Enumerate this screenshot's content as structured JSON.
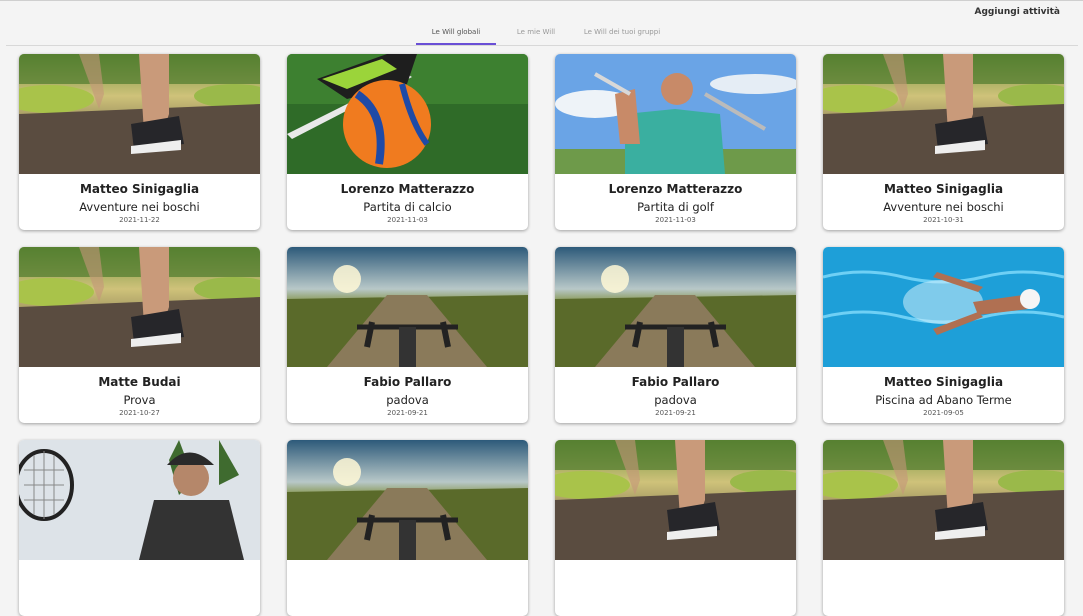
{
  "header": {
    "add_activity_label": "Aggiungi attività"
  },
  "tabs": [
    {
      "label": "Le Will globali",
      "active": true
    },
    {
      "label": "Le mie Will",
      "active": false
    },
    {
      "label": "Le Will dei tuoi gruppi",
      "active": false
    }
  ],
  "accent_color": "#6a4fd6",
  "cards": [
    {
      "name": "Matteo Sinigaglia",
      "activity": "Avventure nei boschi",
      "date": "2021-11-22",
      "image": "walking-photo"
    },
    {
      "name": "Lorenzo Matterazzo",
      "activity": "Partita di calcio",
      "date": "2021-11-03",
      "image": "soccer-photo"
    },
    {
      "name": "Lorenzo Matterazzo",
      "activity": "Partita di golf",
      "date": "2021-11-03",
      "image": "golf-photo"
    },
    {
      "name": "Matteo Sinigaglia",
      "activity": "Avventure nei boschi",
      "date": "2021-10-31",
      "image": "walking-photo"
    },
    {
      "name": "Matte Budai",
      "activity": "Prova",
      "date": "2021-10-27",
      "image": "walking-photo"
    },
    {
      "name": "Fabio Pallaro",
      "activity": "padova",
      "date": "2021-09-21",
      "image": "cycling-photo"
    },
    {
      "name": "Fabio Pallaro",
      "activity": "padova",
      "date": "2021-09-21",
      "image": "cycling-photo"
    },
    {
      "name": "Matteo Sinigaglia",
      "activity": "Piscina ad Abano Terme",
      "date": "2021-09-05",
      "image": "swimming-photo"
    },
    {
      "name": "",
      "activity": "",
      "date": "",
      "image": "tennis-photo"
    },
    {
      "name": "",
      "activity": "",
      "date": "",
      "image": "cycling-photo"
    },
    {
      "name": "",
      "activity": "",
      "date": "",
      "image": "walking-photo"
    },
    {
      "name": "",
      "activity": "",
      "date": "",
      "image": "walking-photo"
    }
  ]
}
